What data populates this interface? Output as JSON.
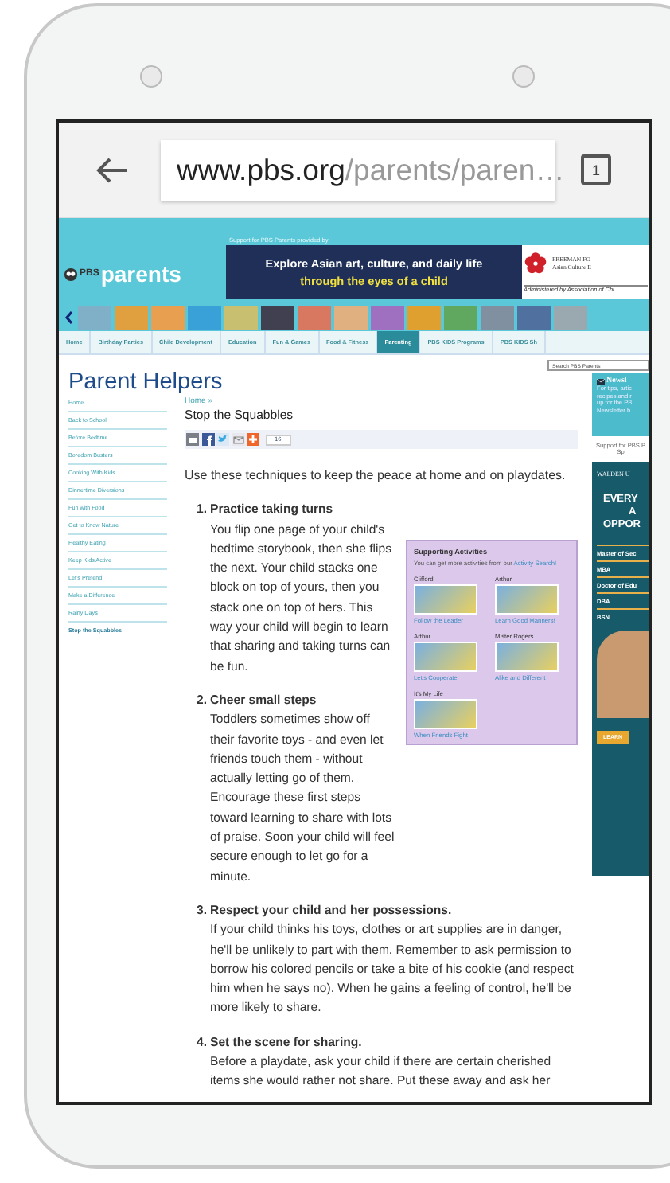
{
  "browser": {
    "url_host": "www.pbs.org",
    "url_path": "/parents/paren…",
    "tab_count": "1"
  },
  "header": {
    "logo_prefix": "PBS",
    "logo_text": "parents",
    "sponsor_label": "Support for PBS Parents provided by:",
    "banner_line1": "Explore Asian art, culture, and daily life",
    "banner_line2": "through the eyes of a child",
    "sponsor_lines": [
      "FREEMAN FO",
      "Asian Culture E"
    ],
    "sponsor_note": "Administered by Association of Chi"
  },
  "nav_tabs": [
    {
      "label": "Home",
      "selected": false
    },
    {
      "label": "Birthday Parties",
      "selected": false
    },
    {
      "label": "Child Development",
      "selected": false
    },
    {
      "label": "Education",
      "selected": false
    },
    {
      "label": "Fun & Games",
      "selected": false
    },
    {
      "label": "Food & Fitness",
      "selected": false
    },
    {
      "label": "Parenting",
      "selected": true
    },
    {
      "label": "PBS KIDS Programs",
      "selected": false
    },
    {
      "label": "PBS KIDS Sh",
      "selected": false
    }
  ],
  "search": {
    "placeholder": "Search PBS Parents"
  },
  "section_title": "Parent Helpers",
  "sidebar": {
    "items": [
      {
        "label": "Home",
        "selected": false
      },
      {
        "label": "Back to School",
        "selected": false
      },
      {
        "label": "Before Bedtime",
        "selected": false
      },
      {
        "label": "Boredom Busters",
        "selected": false
      },
      {
        "label": "Cooking With Kids",
        "selected": false
      },
      {
        "label": "Dinnertime Diversions",
        "selected": false
      },
      {
        "label": "Fun with Food",
        "selected": false
      },
      {
        "label": "Get to Know Nature",
        "selected": false
      },
      {
        "label": "Healthy Eating",
        "selected": false
      },
      {
        "label": "Keep Kids Active",
        "selected": false
      },
      {
        "label": "Let's Pretend",
        "selected": false
      },
      {
        "label": "Make a Difference",
        "selected": false
      },
      {
        "label": "Rainy Days",
        "selected": false
      },
      {
        "label": "Stop the Squabbles",
        "selected": true
      }
    ]
  },
  "article": {
    "breadcrumb": "Home »",
    "title": "Stop the Squabbles",
    "share_count": "16",
    "intro": "Use these techniques to keep the peace at home and on playdates.",
    "steps": [
      {
        "number": "1.",
        "title": "Practice taking turns",
        "body": "You flip one page of your child's bedtime storybook, then she flips the next. Your child stacks one block on top of yours, then you stack one on top of hers. This way your child will begin to learn that sharing and taking turns can be fun."
      },
      {
        "number": "2.",
        "title": "Cheer small steps",
        "body": "Toddlers sometimes show off their favorite toys - and even let friends touch them - without actually letting go of them. Encourage these first steps toward learning to share with lots of praise. Soon your child will feel secure enough to let go for a minute."
      },
      {
        "number": "3.",
        "title": "Respect your child and her possessions.",
        "body": "If your child thinks his toys, clothes or art supplies are in danger, he'll be unlikely to part with them. Remember to ask permission to borrow his colored pencils or take a bite of his cookie (and respect him when he says no). When he gains a feeling of control, he'll be more likely to share."
      },
      {
        "number": "4.",
        "title": "Set the scene for sharing.",
        "body": "Before a playdate, ask your child if there are certain cherished items she would rather not share. Put these away and ask her"
      }
    ]
  },
  "activities": {
    "title": "Supporting Activities",
    "intro": "You can get more activities from our",
    "link": "Activity Search!",
    "items": [
      {
        "show": "Clifford",
        "caption": "Follow the Leader"
      },
      {
        "show": "Arthur",
        "caption": "Learn Good Manners!"
      },
      {
        "show": "Arthur",
        "caption": "Let's Cooperate"
      },
      {
        "show": "Mister Rogers",
        "caption": "Alike and Different"
      },
      {
        "show": "It's My Life",
        "caption": "When Friends Fight"
      }
    ]
  },
  "newsletter": {
    "title": "Newsl",
    "lines": [
      "For tips, artic",
      "recipes and r",
      "up for the PB",
      "Newsletter b"
    ]
  },
  "ad_label": [
    "Support for PBS P",
    "Sp"
  ],
  "ad": {
    "brand": "WALDEN U",
    "headline": [
      "EVERY",
      "A",
      "OPPOR"
    ],
    "programs": [
      "Master of Sec",
      "MBA",
      "Doctor of Edu",
      "DBA",
      "BSN"
    ],
    "button": "LEARN"
  }
}
